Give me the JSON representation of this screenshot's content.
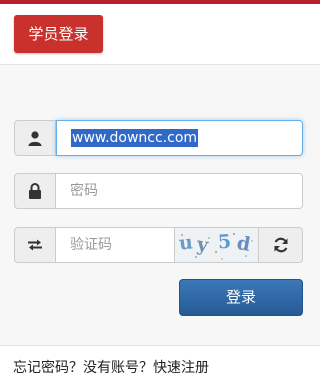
{
  "header": {
    "tab_label": "学员登录"
  },
  "form": {
    "username": {
      "value": "www.downcc.com",
      "icon": "user-icon"
    },
    "password": {
      "placeholder": "密码",
      "icon": "lock-icon"
    },
    "captcha": {
      "placeholder": "验证码",
      "icon": "exchange-icon",
      "image_text": [
        "u",
        "y",
        "5",
        "d"
      ],
      "refresh_icon": "refresh-icon"
    },
    "login_button": "登录"
  },
  "footer": {
    "forgot_password": "忘记密码？",
    "no_account": "没有账号？",
    "quick_register": "快速注册"
  },
  "colors": {
    "brand_red": "#c9312d",
    "button_blue": "#2f6aa8",
    "selection": "#3169c6"
  }
}
